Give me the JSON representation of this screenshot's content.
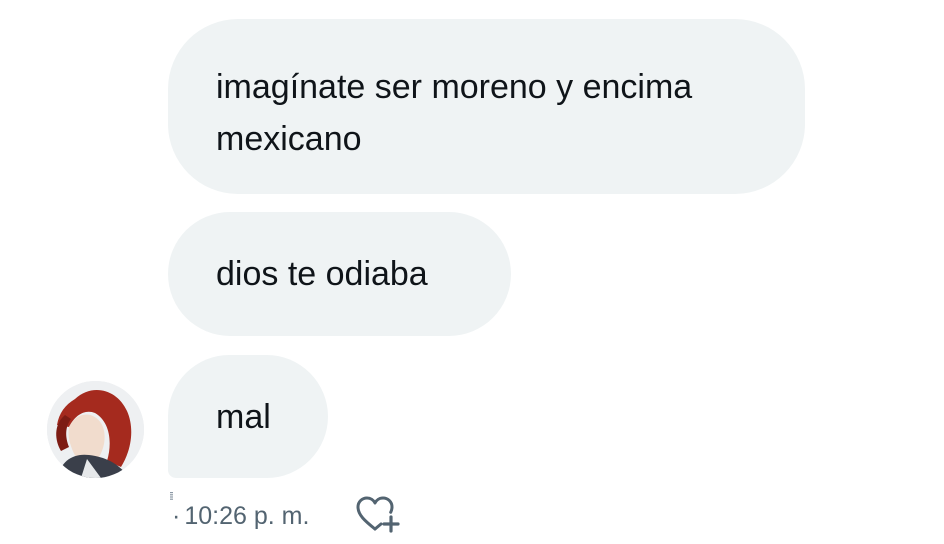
{
  "messages": [
    {
      "text": "imagínate ser moreno y encima mexicano"
    },
    {
      "text": "dios te odiaba"
    },
    {
      "text": "mal"
    }
  ],
  "meta": {
    "separator": "·",
    "timestamp": "10:26 p. m."
  },
  "icons": {
    "react": "heart-plus-icon",
    "avatar": "user-avatar"
  },
  "colors": {
    "bubble": "#eff3f4",
    "text": "#0f1419",
    "meta": "#536471"
  }
}
